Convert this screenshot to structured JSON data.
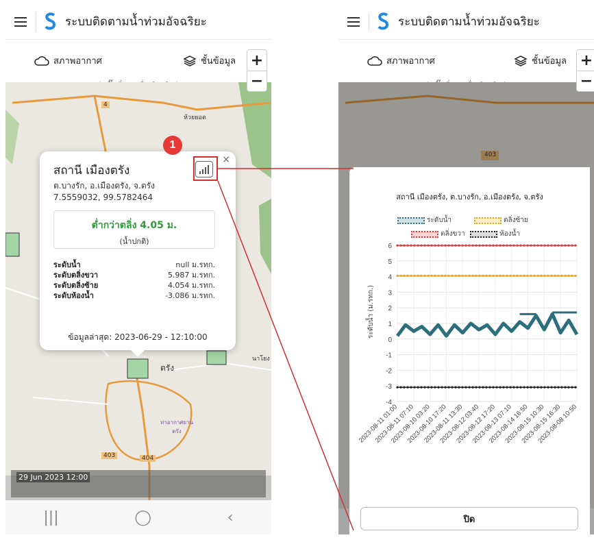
{
  "app": {
    "title": "ระบบติดตามน้ำท่วมอัจฉริยะ"
  },
  "toolbar": {
    "weather": "สภาพอากาศ",
    "layers": "ชั้นข้อมูล",
    "hint": "(คลิ๊กที่เมนูเพื่อเปิด/ปิด)",
    "zoom_in": "+",
    "zoom_out": "−"
  },
  "map_labels": {
    "road4": "4",
    "huai_yot": "ห้วยยอด",
    "road403a": "403",
    "road403b": "403",
    "road404": "404",
    "trang": "ตรัง",
    "naiyong": "นาโยง",
    "airport": "ท่าอากาศยาน ตรัง"
  },
  "popup": {
    "title": "สถานี เมืองตรัง",
    "address": "ต.บางรัก, อ.เมืองตรัง, จ.ตรัง",
    "coords": "7.5559032, 99.5782464",
    "status_main": "ต่ำกว่าตลิ่ง 4.05 ม.",
    "status_sub": "(น้ำปกติ)",
    "levels": [
      {
        "label": "ระดับน้ำ",
        "value": "null ม.รทก."
      },
      {
        "label": "ระดับตลิ่งขวา",
        "value": "5.987 ม.รทก."
      },
      {
        "label": "ระดับตลิ่งซ้าย",
        "value": "4.054 ม.รทก."
      },
      {
        "label": "ระดับห้องน้ำ",
        "value": "-3.086 ม.รทก."
      }
    ],
    "updated": "ข้อมูลล่าสุด: 2023-06-29 - 12:10:00",
    "close": "×",
    "badge": "1"
  },
  "timebar": {
    "label": "29 Jun 2023 12:00"
  },
  "dialog": {
    "close_label": "ปิด"
  },
  "chart_data": {
    "type": "line",
    "title": "สถานี เมืองตรัง, ต.บางรัก, อ.เมืองตรัง, จ.ตรัง",
    "ylabel": "ระดับน้ำ (ม.รทก.)",
    "xlabel": "",
    "ylim": [
      -4,
      6
    ],
    "yticks": [
      6,
      5,
      4,
      3,
      2,
      1,
      0,
      -1,
      -2,
      -3,
      -4
    ],
    "categories": [
      "2023-08-11 01:00",
      "2023-08-11 07:10",
      "2023-08-10 03:20",
      "2023-08-10 17:20",
      "2023-08-11 13:30",
      "2023-08-12 03:40",
      "2023-08-12 17:20",
      "2023-08-13 07:10",
      "2023-08-14 16:50",
      "2023-08-15 10:30",
      "2023-08-15 16:30",
      "2023-08-08 10:50"
    ],
    "series": [
      {
        "name": "ระดับน้ำ",
        "color": "#2c6e7b",
        "values": [
          0.2,
          0.9,
          0.5,
          0.8,
          0.3,
          0.9,
          0.2,
          0.9,
          0.4,
          1.0,
          0.6,
          0.9,
          0.3,
          1.0,
          0.5,
          1.1,
          0.7,
          1.5,
          0.6,
          1.6,
          0.4,
          1.2,
          0.3
        ]
      },
      {
        "name": "ตลิ่งซ้าย",
        "color": "#e6a817",
        "values": [
          4.05,
          4.05
        ]
      },
      {
        "name": "ตลิ่งขวา",
        "color": "#e53935",
        "values": [
          5.99,
          5.99
        ]
      },
      {
        "name": "ห้องน้ำ",
        "color": "#222222",
        "values": [
          -3.09,
          -3.09
        ]
      }
    ],
    "grid": true,
    "legend": "top"
  }
}
